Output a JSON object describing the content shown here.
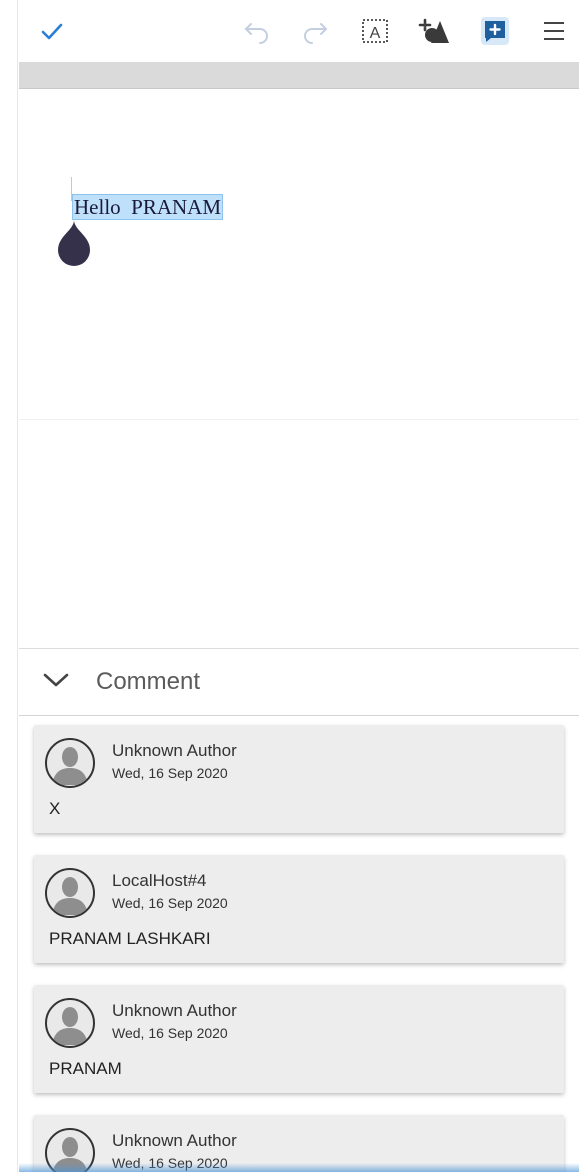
{
  "toolbar": {
    "icons": [
      "checkmark-icon",
      "undo-icon",
      "redo-icon",
      "text-box-icon",
      "add-shape-icon",
      "add-comment-icon",
      "hamburger-menu-icon"
    ],
    "accent": "#2a7fd4"
  },
  "document": {
    "text": "Hello  PRANAM",
    "selection_color": "#bfe0fb"
  },
  "comments_panel": {
    "title": "Comment",
    "items": [
      {
        "author": "Unknown Author",
        "date": "Wed, 16 Sep 2020",
        "text": "X"
      },
      {
        "author": "LocalHost#4",
        "date": "Wed, 16 Sep 2020",
        "text": "PRANAM LASHKARI"
      },
      {
        "author": "Unknown Author",
        "date": "Wed, 16 Sep 2020",
        "text": "PRANAM"
      },
      {
        "author": "Unknown Author",
        "date": "Wed, 16 Sep 2020",
        "text": ""
      }
    ]
  }
}
